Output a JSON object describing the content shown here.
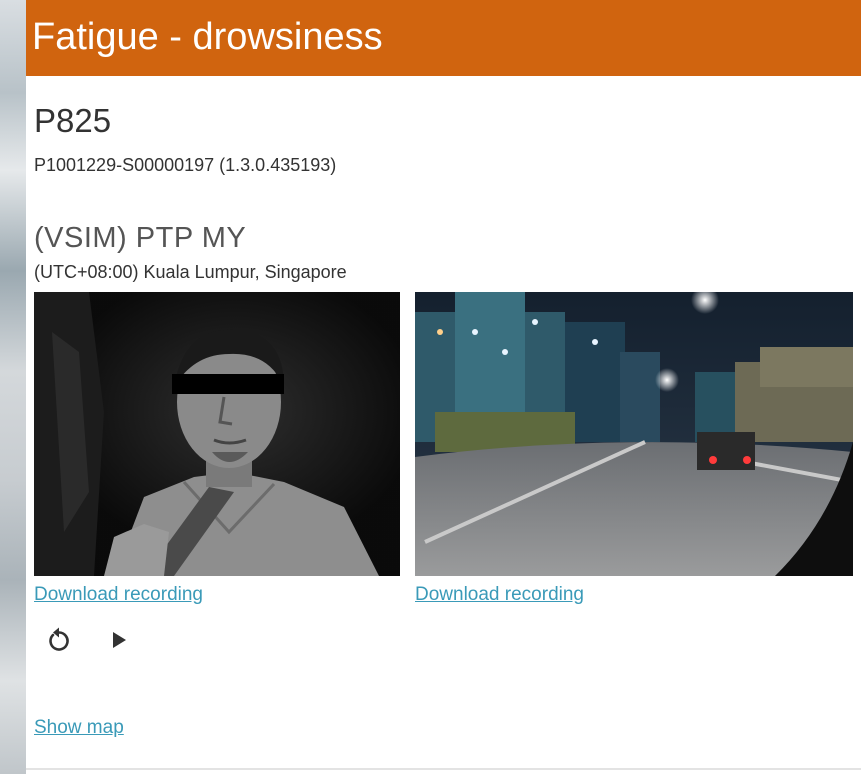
{
  "header": {
    "title": "Fatigue - drowsiness"
  },
  "vehicle": {
    "name": "P825",
    "device_id": "P1001229-S00000197 (1.3.0.435193)"
  },
  "fleet": {
    "name": "(VSIM) PTP MY",
    "timezone": "(UTC+08:00) Kuala Lumpur, Singapore"
  },
  "cameras": {
    "driver": {
      "download_label": "Download recording"
    },
    "road": {
      "download_label": "Download recording"
    }
  },
  "controls": {
    "replay_icon": "replay-icon",
    "play_icon": "play-icon"
  },
  "map": {
    "show_label": "Show map"
  },
  "colors": {
    "header_bg": "#d0640f",
    "link": "#3a9ab8"
  }
}
